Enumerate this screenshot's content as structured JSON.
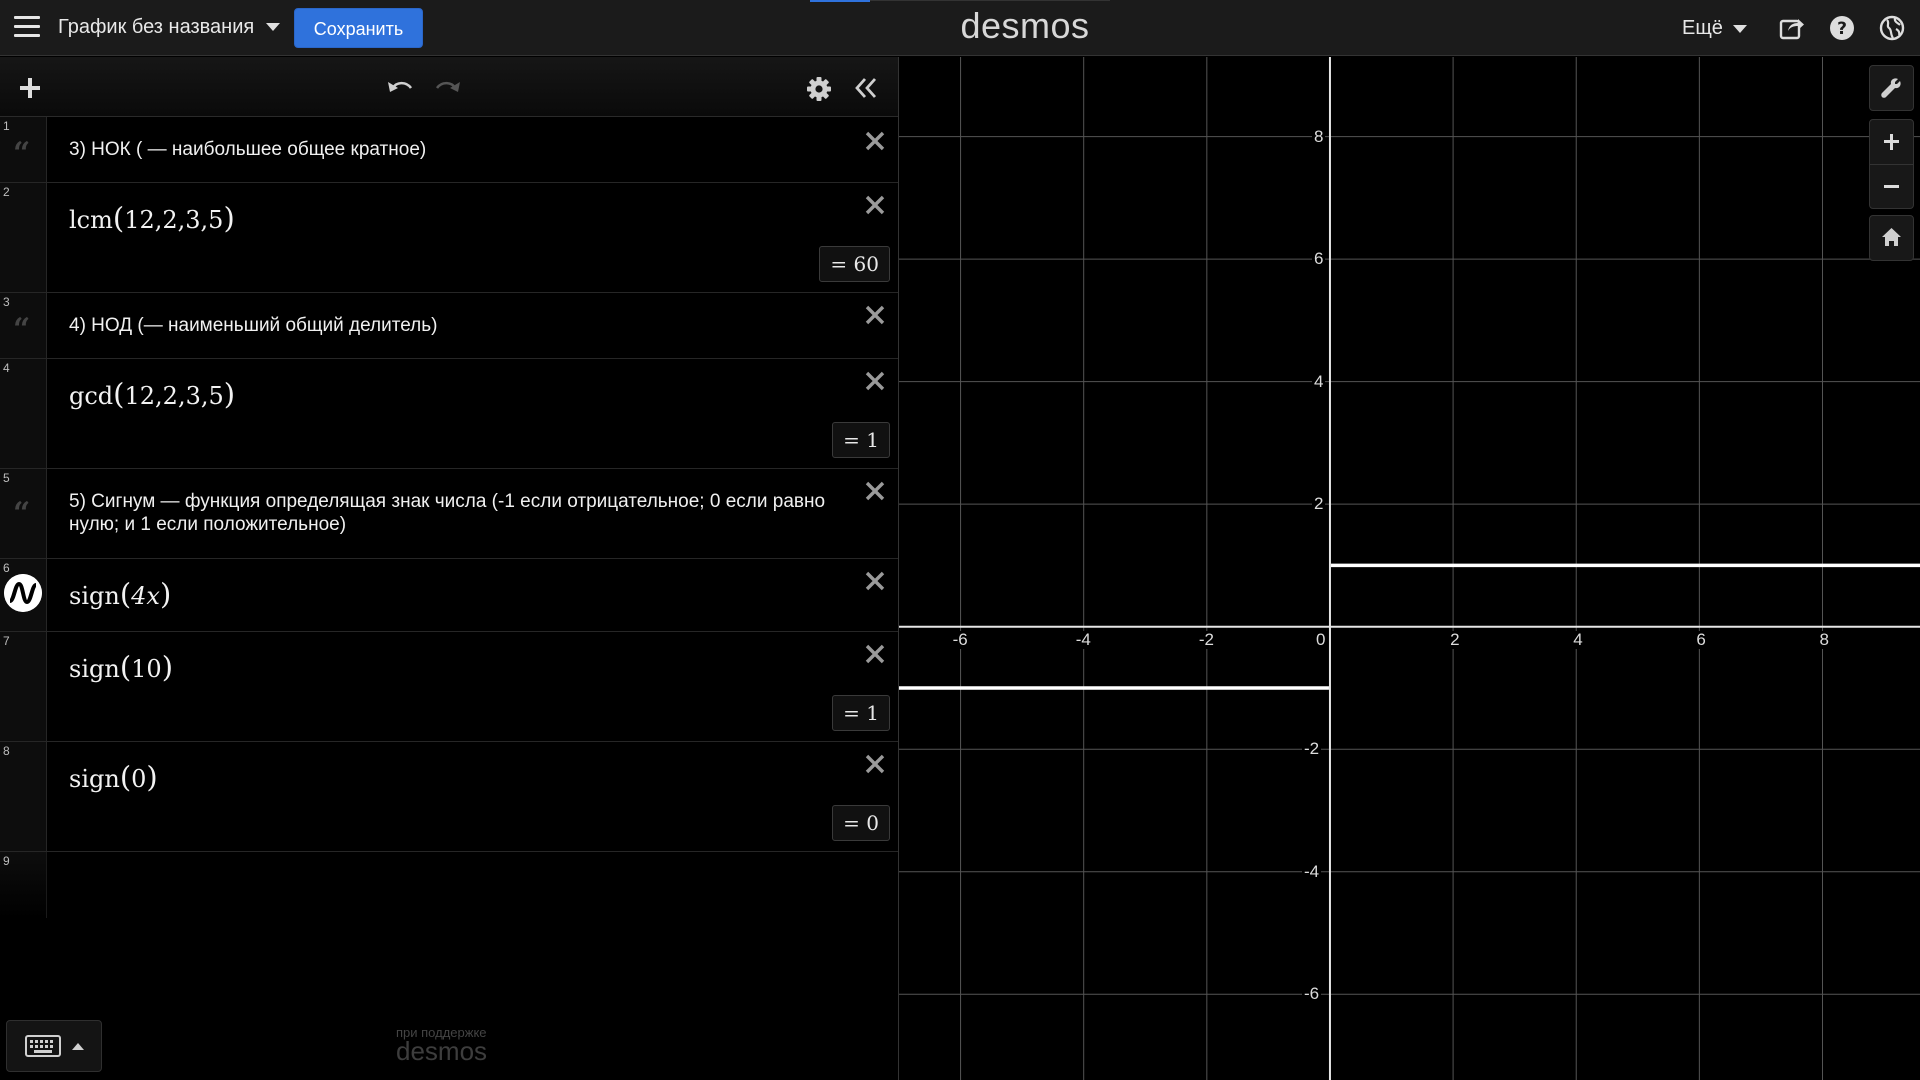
{
  "header": {
    "title": "График без названия",
    "save_label": "Сохранить",
    "logo": "desmos",
    "more_label": "Ещё"
  },
  "expressions": [
    {
      "index": "1",
      "type": "note",
      "text": "3) НОК ( — наибольшее общее кратное)"
    },
    {
      "index": "2",
      "type": "math",
      "fn": "lcm",
      "args": "12,2,3,5",
      "result": "= 60"
    },
    {
      "index": "3",
      "type": "note",
      "text": "4) НОД (— наименьший общий делитель)"
    },
    {
      "index": "4",
      "type": "math",
      "fn": "gcd",
      "args": "12,2,3,5",
      "result": "= 1"
    },
    {
      "index": "5",
      "type": "note",
      "text": "5) Сигнум — функция определящая знак числа (-1 если отрицательное; 0 если равно нулю; и 1 если положительное)"
    },
    {
      "index": "6",
      "type": "math",
      "fn": "sign",
      "args": "4x"
    },
    {
      "index": "7",
      "type": "math",
      "fn": "sign",
      "args": "10",
      "result": "= 1"
    },
    {
      "index": "8",
      "type": "math",
      "fn": "sign",
      "args": "0",
      "result": "= 0"
    },
    {
      "index": "9",
      "type": "empty"
    }
  ],
  "footer": {
    "powered_by": "при поддержке",
    "brand": "desmos"
  },
  "graph": {
    "x_ticks": [
      "-6",
      "-4",
      "-2",
      "0",
      "2",
      "4",
      "6",
      "8"
    ],
    "y_ticks": [
      "8",
      "6",
      "4",
      "2",
      "-2",
      "-4",
      "-6"
    ],
    "x_range": [
      -7,
      9.6
    ],
    "y_range": [
      -7.4,
      9.3
    ],
    "plotted_function": "sign(4x)",
    "curve_color": "#ffffff",
    "grid_color": "#555555",
    "background": "#000000"
  },
  "colors": {
    "accent": "#2f72dc",
    "header_bg": "#1b1b1b",
    "panel_bg": "#000000"
  },
  "icons": [
    "menu-icon",
    "caret-down-icon",
    "add-icon",
    "undo-icon",
    "redo-icon",
    "settings-icon",
    "collapse-icon",
    "note-quote-icon",
    "close-icon",
    "graph-wave-icon",
    "share-icon",
    "help-icon",
    "language-icon",
    "wrench-icon",
    "zoom-in-icon",
    "zoom-out-icon",
    "home-icon",
    "keyboard-icon"
  ]
}
